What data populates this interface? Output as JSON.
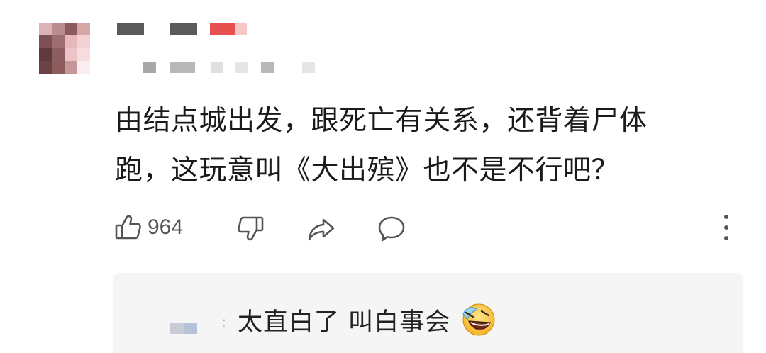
{
  "comment": {
    "text_line1": "由结点城出发，跟死亡有关系，还背着尸体",
    "text_line2": "跑，这玩意叫《大出殡》也不是不行吧？"
  },
  "actions": {
    "like_count": "964",
    "like_icon": "thumbs-up-icon",
    "dislike_icon": "thumbs-down-icon",
    "share_icon": "share-icon",
    "comment_icon": "comment-bubble-icon",
    "more_icon": "more-vertical-icon"
  },
  "reply": {
    "colon": ":",
    "text": "太直白了 叫白事会",
    "emoji_icon": "laughing-tears-emoji"
  },
  "colors": {
    "text": "#1a1a1a",
    "icon": "#555555",
    "reply_bg": "#f5f5f5",
    "name_accent": "#e84a4a"
  }
}
